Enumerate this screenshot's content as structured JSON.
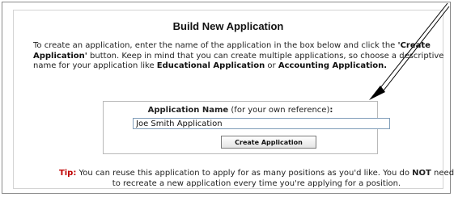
{
  "title": "Build New Application",
  "intro": {
    "part1": "To create an application, enter the name of the application in the box below and click the ",
    "button_ref": "'Create Application'",
    "part2": " button. Keep in mind that you can create multiple applications, so choose a descriptive name for your application like ",
    "example1": "Educational Application",
    "or": " or ",
    "example2": "Accounting Application."
  },
  "form": {
    "label_bold": "Application Name",
    "label_note": " (for your own reference)",
    "label_colon": ":",
    "name_value": "Joe Smith Application",
    "button_label": "Create Application"
  },
  "tip": {
    "label": "Tip:",
    "text1": " You can reuse this application to apply for as many positions as you'd like. You do ",
    "not": "NOT",
    "text2": " need to recreate a new application every time you're applying for a position."
  },
  "annotation_color": "#000000"
}
